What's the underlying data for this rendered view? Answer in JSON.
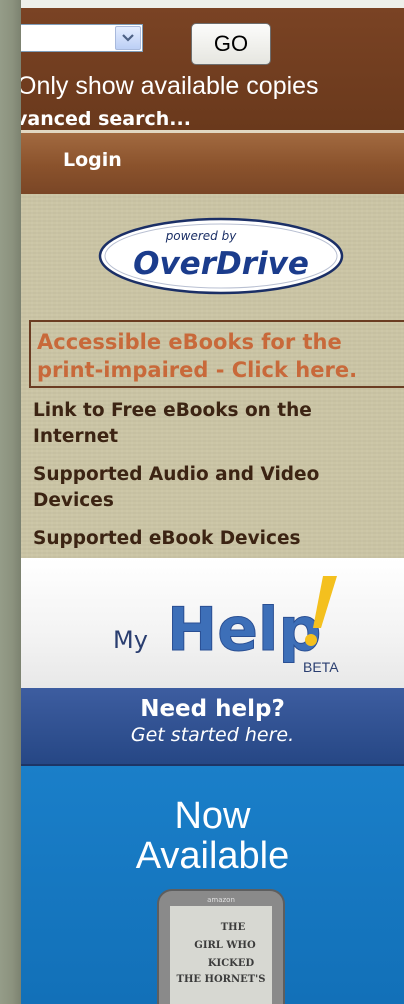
{
  "search": {
    "select_value": "",
    "go_label": "GO",
    "available_label": "Only show available copies",
    "advanced_label": "vanced search..."
  },
  "nav": {
    "login_label": "Login"
  },
  "overdrive": {
    "powered_by": "powered by",
    "brand": "OverDrive"
  },
  "links": {
    "accessible": "Accessible eBooks for the print-impaired - Click here.",
    "free_ebooks": "Link to Free eBooks on the Internet",
    "audio_video": "Supported Audio and Video Devices",
    "ebook_devices": "Supported eBook Devices"
  },
  "myhelp": {
    "my": "My",
    "help": "Help",
    "beta": "BETA",
    "need_help": "Need help?",
    "get_started": "Get started here."
  },
  "promo": {
    "line1": "Now",
    "line2": "Available",
    "device_brand": "amazon",
    "book_text": [
      "THE",
      "GIRL WHO",
      "KICKED",
      "THE HORNET'S"
    ]
  },
  "colors": {
    "brown_panel": "#6b3a1e",
    "login_bar": "#8a522c",
    "tan_panel": "#cbc5a5",
    "accessible_link": "#c8693a",
    "help_blue": "#264785",
    "promo_blue": "#1270b8"
  }
}
